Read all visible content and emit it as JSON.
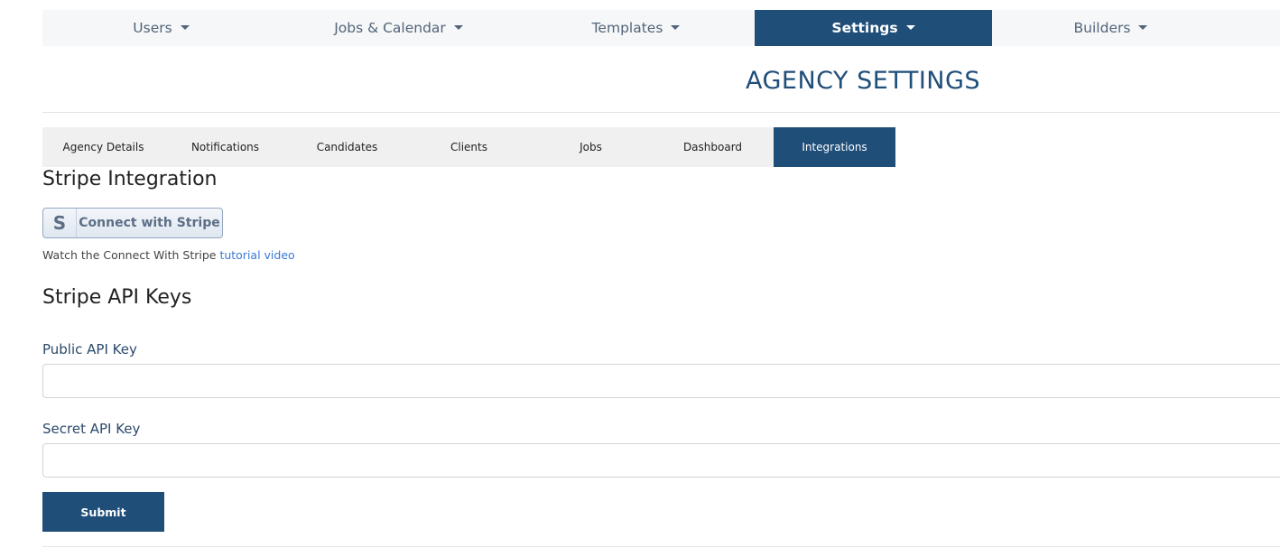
{
  "topnav": {
    "items": [
      {
        "label": "Users",
        "active": false
      },
      {
        "label": "Jobs & Calendar",
        "active": false
      },
      {
        "label": "Templates",
        "active": false
      },
      {
        "label": "Settings",
        "active": true
      },
      {
        "label": "Builders",
        "active": false
      }
    ]
  },
  "page": {
    "title": "AGENCY SETTINGS"
  },
  "subtabs": {
    "items": [
      {
        "label": "Agency Details",
        "active": false
      },
      {
        "label": "Notifications",
        "active": false
      },
      {
        "label": "Candidates",
        "active": false
      },
      {
        "label": "Clients",
        "active": false
      },
      {
        "label": "Jobs",
        "active": false
      },
      {
        "label": "Dashboard",
        "active": false
      },
      {
        "label": "Integrations",
        "active": true
      }
    ]
  },
  "stripe": {
    "heading": "Stripe Integration",
    "connect_icon_letter": "S",
    "connect_label": "Connect with Stripe",
    "help_prefix": "Watch the Connect With Stripe ",
    "help_link": "tutorial video"
  },
  "api_keys": {
    "heading": "Stripe API Keys",
    "public_label": "Public API Key",
    "public_value": "",
    "secret_label": "Secret API Key",
    "secret_value": ""
  },
  "form": {
    "submit_label": "Submit"
  },
  "colors": {
    "primary": "#1f4e79",
    "nav_background": "#f6f7f8",
    "tab_background": "#f0f0f0",
    "link": "#3a78d8"
  }
}
